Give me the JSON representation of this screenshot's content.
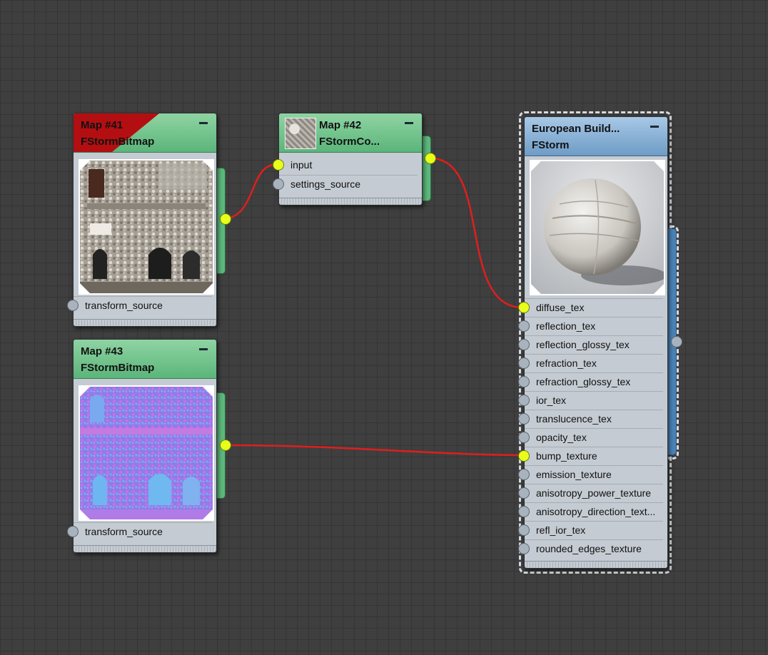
{
  "nodes": {
    "map41": {
      "title": "Map #41",
      "subtitle": "FStormBitmap",
      "ports": [
        "transform_source"
      ]
    },
    "map42": {
      "title": "Map #42",
      "subtitle": "FStormCo...",
      "ports": [
        "input",
        "settings_source"
      ]
    },
    "map43": {
      "title": "Map #43",
      "subtitle": "FStormBitmap",
      "ports": [
        "transform_source"
      ]
    },
    "material": {
      "title": "European Build...",
      "subtitle": "FStorm",
      "ports": [
        "diffuse_tex",
        "reflection_tex",
        "reflection_glossy_tex",
        "refraction_tex",
        "refraction_glossy_tex",
        "ior_tex",
        "translucence_tex",
        "opacity_tex",
        "bump_texture",
        "emission_texture",
        "anisotropy_power_texture",
        "anisotropy_direction_text...",
        "refl_ior_tex",
        "rounded_edges_texture"
      ]
    }
  },
  "colors": {
    "map_header": "#5bb57a",
    "material_header": "#6e9cc6",
    "wire": "#e01e1e",
    "active_port": "#e8ff1a",
    "error_flag": "#b30f12"
  },
  "icons": {
    "minimize": "minimize-icon",
    "port": "socket-icon"
  }
}
